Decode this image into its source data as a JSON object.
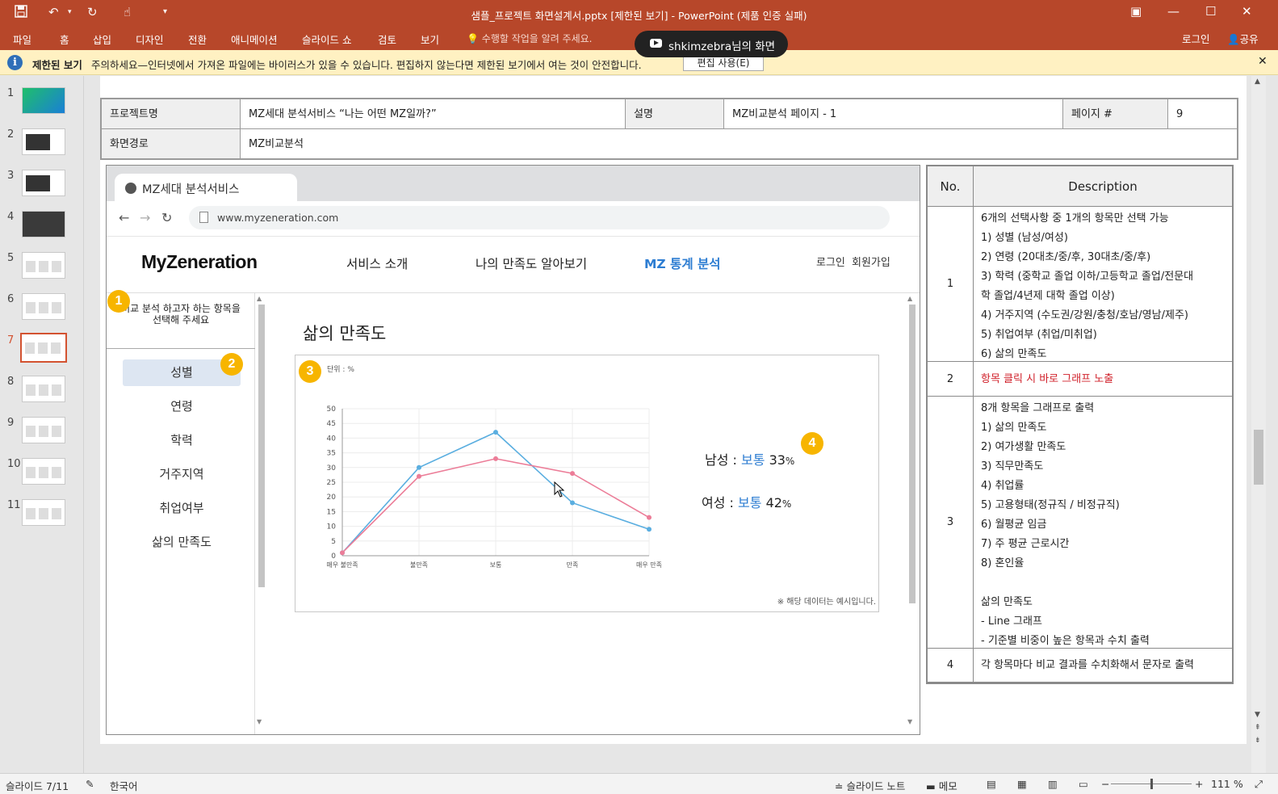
{
  "window": {
    "title": "샘플_프로젝트 화면설계서.pptx [제한된 보기] - PowerPoint (제품 인증 실패)",
    "quick_access": [
      "save-icon",
      "undo-icon",
      "redo-icon",
      "touch-mode-icon",
      "customize-icon"
    ]
  },
  "menu": {
    "tabs": [
      "파일",
      "홈",
      "삽입",
      "디자인",
      "전환",
      "애니메이션",
      "슬라이드 쇼",
      "검토",
      "보기"
    ],
    "tell_me": "수행할 작업을 알려 주세요.",
    "login": "로그인",
    "share": "공유"
  },
  "screen_share": {
    "text": "shkimzebra님의 화면"
  },
  "protected_view": {
    "label": "제한된 보기",
    "message": "주의하세요—인터넷에서 가져온 파일에는 바이러스가 있을 수 있습니다. 편집하지 않는다면 제한된 보기에서 여는 것이 안전합니다.",
    "button": "편집 사용(E)"
  },
  "thumbnails": {
    "numbers": [
      "1",
      "2",
      "3",
      "4",
      "5",
      "6",
      "7",
      "8",
      "9",
      "10",
      "11"
    ],
    "active": 7
  },
  "header_table": {
    "project_label": "프로젝트명",
    "project_value": "MZ세대 분석서비스 “나는 어떤 MZ일까?”",
    "desc_label": "설명",
    "desc_value": "MZ비교분석 페이지 - 1",
    "page_label": "페이지 #",
    "page_value": "9",
    "path_label": "화면경로",
    "path_value": "MZ비교분석"
  },
  "mockup": {
    "tab_title": "MZ세대 분석서비스",
    "url": "www.myzeneration.com",
    "logo": "MyZeneration",
    "nav": [
      "서비스 소개",
      "나의 만족도 알아보기",
      "MZ 통계 분석"
    ],
    "login": "로그인",
    "signup": "회원가입",
    "prompt_line1": "비교 분석 하고자 하는 항목을",
    "prompt_line2": "선택해 주세요",
    "categories": [
      "성별",
      "연령",
      "학력",
      "거주지역",
      "취업여부",
      "삶의 만족도"
    ],
    "section_title": "삶의 만족도",
    "unit": "단위 : %",
    "note": "※ 해당 데이터는 예시입니다.",
    "result_male_label": "남성 :",
    "result_male_value": "보통",
    "result_male_pct": "33",
    "result_female_label": "여성 :",
    "result_female_value": "보통",
    "result_female_pct": "42",
    "pct_sign": "%"
  },
  "badges": [
    "1",
    "2",
    "3",
    "4"
  ],
  "chart_data": {
    "type": "line",
    "categories": [
      "매우 불만족",
      "불만족",
      "보통",
      "만족",
      "매우 만족"
    ],
    "series": [
      {
        "values": [
          1,
          30,
          42,
          18,
          9
        ],
        "color": "#5aaee0"
      },
      {
        "values": [
          1,
          27,
          33,
          28,
          13
        ],
        "color": "#ec7d98"
      }
    ],
    "ylim": [
      0,
      50
    ],
    "yticks": [
      "0",
      "5",
      "10",
      "15",
      "20",
      "25",
      "30",
      "35",
      "40",
      "45",
      "50"
    ],
    "grid": true
  },
  "description_table": {
    "col_no": "No.",
    "col_desc": "Description",
    "rows": [
      {
        "no": "1",
        "lines": [
          "6개의 선택사항 중 1개의 항목만 선택 가능",
          "1)   성별 (남성/여성)",
          "2)   연령 (20대초/중/후, 30대초/중/후)",
          "3)   학력 (중학교 졸업 이하/고등학교 졸업/전문대",
          "학 졸업/4년제 대학 졸업 이상)",
          "4)   거주지역 (수도권/강원/충청/호남/영남/제주)",
          "5)   취업여부 (취업/미취업)",
          "6)   삶의 만족도"
        ]
      },
      {
        "no": "2",
        "lines": [
          "항목 클릭 시 바로 그래프 노출"
        ]
      },
      {
        "no": "3",
        "lines": [
          "8개 항목을 그래프로 출력",
          "1)   삶의 만족도",
          "2)   여가생활 만족도",
          "3)   직무만족도",
          "4)   취업률",
          "5)   고용형태(정규직 / 비정규직)",
          "6)   월평균 임금",
          "7)   주 평균 근로시간",
          "8)   혼인율",
          "",
          "삶의 만족도",
          "-    Line 그래프",
          "-    기준별 비중이 높은 항목과 수치 출력"
        ]
      },
      {
        "no": "4",
        "lines": [
          "각 항목마다 비교 결과를 수치화해서 문자로 출력"
        ]
      }
    ]
  },
  "statusbar": {
    "slide": "슬라이드 7/11",
    "language": "한국어",
    "notes": "슬라이드 노트",
    "comments": "메모",
    "zoom": "111 %"
  }
}
